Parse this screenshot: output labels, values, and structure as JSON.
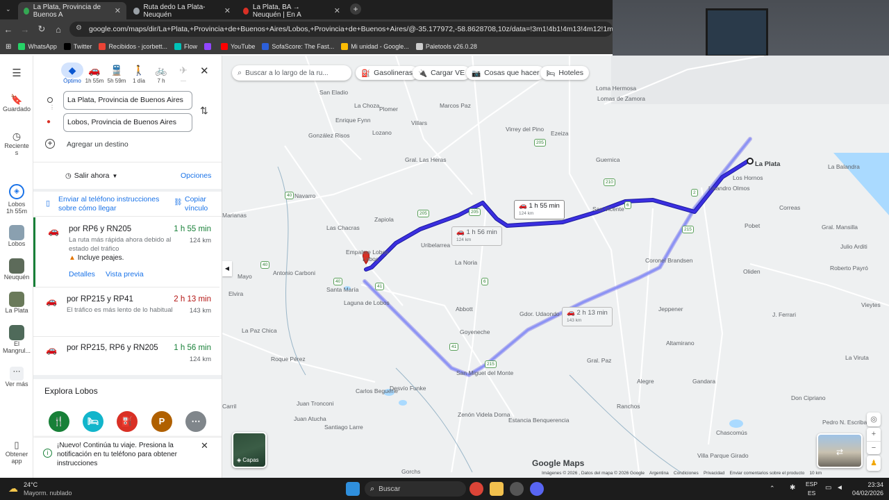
{
  "browser": {
    "tabs": [
      {
        "title": "La Plata, Provincia de Buenos A",
        "color": "#34a853",
        "active": true
      },
      {
        "title": "Ruta dedo La Plata-Neuquén",
        "color": "#9aa0a6",
        "active": false
      },
      {
        "title": "La Plata, BA → Neuquén | En A",
        "color": "#d93025",
        "active": false
      }
    ],
    "url": "google.com/maps/dir/La+Plata,+Provincia+de+Buenos+Aires/Lobos,+Provincia+de+Buenos+Aires/@-35.177972,-58.8628708,10z/data=!3m1!4b1!4m13!4m12!1m5!1m1!1s0x95a2e62",
    "bookmarks": [
      {
        "label": "WhatsApp",
        "color": "#25d366"
      },
      {
        "label": "Twitter",
        "color": "#000000"
      },
      {
        "label": "Recibidos - jcorbett...",
        "color": "#ea4335"
      },
      {
        "label": "Flow",
        "color": "#00c2b8"
      },
      {
        "label": "",
        "color": "#9146ff"
      },
      {
        "label": "YouTube",
        "color": "#ff0000"
      },
      {
        "label": "SofaScore: The Fast...",
        "color": "#2c5fd8"
      },
      {
        "label": "Mi unidad - Google...",
        "color": "#fbbc04"
      },
      {
        "label": "Paletools v26.0.28",
        "color": "#cccccc"
      }
    ]
  },
  "rail": {
    "items": [
      {
        "label": "Guardado"
      },
      {
        "label": "Reciente s"
      },
      {
        "label": "Lobos 1h 55m"
      },
      {
        "label": "Lobos"
      },
      {
        "label": "Neuquén"
      },
      {
        "label": "La Plata"
      },
      {
        "label": "El Mangrul..."
      },
      {
        "label": "Ver más"
      },
      {
        "label": "Obtener app"
      }
    ]
  },
  "panel": {
    "modes": [
      {
        "icon": "◆",
        "label": "Óptimo",
        "active": true
      },
      {
        "icon": "🚗",
        "label": "1h 55m",
        "active": false
      },
      {
        "icon": "🚆",
        "label": "5h 59m",
        "active": false
      },
      {
        "icon": "🚶",
        "label": "1 día",
        "active": false
      },
      {
        "icon": "🚲",
        "label": "7 h",
        "active": false
      },
      {
        "icon": "✈",
        "label": "—",
        "active": false
      }
    ],
    "origin": "La Plata, Provincia de Buenos Aires",
    "destination": "Lobos, Provincia de Buenos Aires",
    "add_destination": "Agregar un destino",
    "depart": "Salir ahora",
    "options": "Opciones",
    "send_phone": "Enviar al teléfono instrucciones sobre cómo llegar",
    "copy_link": "Copiar vínculo",
    "routes": [
      {
        "title": "por RP6 y RN205",
        "time": "1 h 55 min",
        "km": "124 km",
        "desc": "La ruta más rápida ahora debido al estado del tráfico",
        "warn": "Incluye peajes.",
        "details": "Detalles",
        "preview": "Vista previa",
        "time_color": "#188038"
      },
      {
        "title": "por RP215 y RP41",
        "time": "2 h 13 min",
        "km": "143 km",
        "desc": "El tráfico es más lento de lo habitual",
        "time_color": "#b31412"
      },
      {
        "title": "por RP215, RP6 y RN205",
        "time": "1 h 56 min",
        "km": "124 km",
        "desc": "",
        "time_color": "#188038"
      }
    ],
    "explore_title": "Explora Lobos",
    "explore_icons": [
      {
        "name": "restaurant",
        "glyph": "🍴",
        "color": "#188038"
      },
      {
        "name": "hotel",
        "glyph": "🛏",
        "color": "#12b5cb"
      },
      {
        "name": "gas",
        "glyph": "⛽",
        "color": "#d93025"
      },
      {
        "name": "parking",
        "glyph": "P",
        "color": "#b06000"
      },
      {
        "name": "more",
        "glyph": "⋯",
        "color": "#80868b"
      }
    ],
    "notice": "¡Nuevo! Continúa tu viaje. Presiona la notificación en tu teléfono para obtener instrucciones"
  },
  "map": {
    "search_placeholder": "Buscar a lo largo de la ru...",
    "chips": [
      "Gasolineras",
      "Cargar VE",
      "Cosas que hacer",
      "Hoteles"
    ],
    "route_boxes": [
      {
        "time": "1 h 55 min",
        "km": "124 km"
      },
      {
        "time": "1 h 56 min",
        "km": "124 km"
      },
      {
        "time": "2 h 13 min",
        "km": "143 km"
      }
    ],
    "places": [
      "San Eladio",
      "La Choza",
      "Plomer",
      "Marcos Paz",
      "Loma Hermosa",
      "Lomas de Zamora",
      "Enrique Fynn",
      "Villars",
      "González Risos",
      "Lozano",
      "Virrey del Pino",
      "Ezeiza",
      "Gral. Las Heras",
      "Guernica",
      "La Plata",
      "La Balandra",
      "Lisandro Olmos",
      "Los Hornos",
      "Navarro",
      "Zapiola",
      "San Vicente",
      "Correas",
      "Gral. Mansilla",
      "Marianas",
      "Las Chacras",
      "Uribelarrea",
      "Pobet",
      "Empalme Lobos",
      "La Noria",
      "Coronel Brandsen",
      "Julio Arditi",
      "Antonio Carboni",
      "Lobos",
      "Oliden",
      "Roberto Payró",
      "Mayo",
      "Elvira",
      "Santa María",
      "Laguna de Lobos",
      "Abbott",
      "Jeppener",
      "Gdor. Udaondo",
      "J. Ferrari",
      "La Paz Chica",
      "Goyeneche",
      "Altamirano",
      "Roque Pérez",
      "San Miguel del Monte",
      "Gral. Paz",
      "Alegre",
      "Gandara",
      "La Viruta",
      "Carlos Beguerie",
      "Desvío Funke",
      "Juan Tronconi",
      "Zenón Videla Dorna",
      "Ranchos",
      "Don Cipriano",
      "Carril",
      "Juan Atucha",
      "Santiago Larre",
      "Estancia Benquerencia",
      "Chascomús",
      "Pedro N. Escribano",
      "Villa Parque Girado",
      "Gorchs",
      "Vieytes"
    ],
    "layers_label": "Capas",
    "brand": "Google Maps",
    "attribution": [
      "Imágenes © 2026 , Datos del mapa © 2026 Google",
      "Argentina",
      "Condiciones",
      "Privacidad",
      "Enviar comentarios sobre el producto",
      "10 km"
    ]
  },
  "taskbar": {
    "weather_temp": "24°C",
    "weather_desc": "Mayorm. nublado",
    "search": "Buscar",
    "lang1": "ESP",
    "lang2": "ES",
    "time": "23:34",
    "date": "04/02/2026"
  }
}
